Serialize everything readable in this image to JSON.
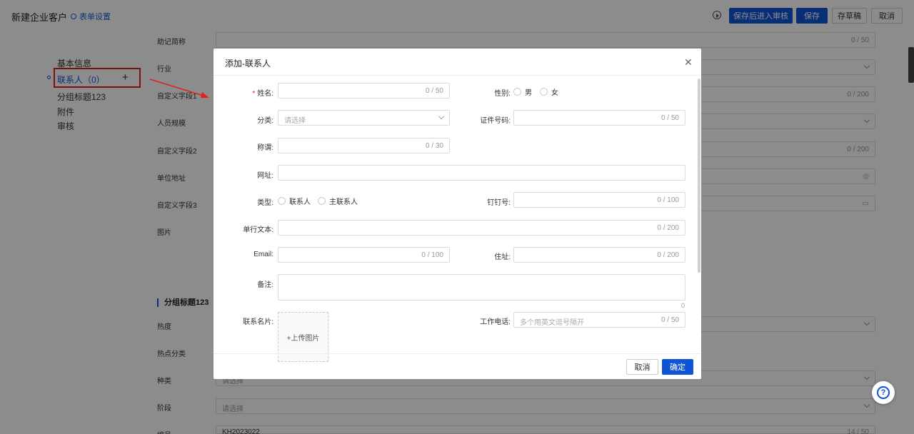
{
  "header": {
    "title": "新建企业客户",
    "form_settings": "表单设置",
    "buttons": {
      "save_and_review": "保存后进入审核",
      "save": "保存",
      "draft": "存草稿",
      "cancel": "取消"
    }
  },
  "sidebar": {
    "items": [
      "基本信息",
      "联系人（0）",
      "分组标题123",
      "附件",
      "审核"
    ]
  },
  "form": {
    "fields": [
      {
        "label": "助记简称",
        "count": "0 / 50"
      },
      {
        "label": "行业"
      },
      {
        "label": "自定义字段1",
        "count": "0 / 200"
      },
      {
        "label": "人员规模"
      },
      {
        "label": "自定义字段2",
        "count": "0 / 200"
      },
      {
        "label": "单位地址"
      },
      {
        "label": "自定义字段3"
      },
      {
        "label": "图片"
      }
    ],
    "section_title": "分组标题123",
    "section_fields": [
      {
        "label": "热度"
      },
      {
        "label": "热点分类"
      },
      {
        "label": "种类",
        "placeholder": "请选择"
      },
      {
        "label": "阶段",
        "placeholder": "请选择"
      },
      {
        "label": "编号",
        "value": "KH2023022",
        "count": "14 / 50"
      }
    ]
  },
  "modal": {
    "title": "添加-联系人",
    "fields": {
      "name": {
        "label": "姓名:",
        "count": "0 / 50"
      },
      "gender": {
        "label": "性别:",
        "options": [
          "男",
          "女"
        ]
      },
      "category": {
        "label": "分类:",
        "placeholder": "请选择"
      },
      "id_number": {
        "label": "证件号码:",
        "count": "0 / 50"
      },
      "title": {
        "label": "称谓:",
        "count": "0 / 30"
      },
      "website": {
        "label": "网址:"
      },
      "type": {
        "label": "类型:",
        "options": [
          "联系人",
          "主联系人"
        ]
      },
      "dingtalk": {
        "label": "钉钉号:",
        "count": "0 / 100"
      },
      "single_line": {
        "label": "单行文本:",
        "count": "0 / 200"
      },
      "email": {
        "label": "Email:",
        "count": "0 / 100"
      },
      "address": {
        "label": "住址:",
        "count": "0 / 200"
      },
      "remark": {
        "label": "备注:",
        "count": "0"
      },
      "business_card": {
        "label": "联系名片:",
        "upload_label": "+上传图片"
      },
      "work_phone": {
        "label": "工作电话:",
        "placeholder": "多个用英文逗号隔开",
        "count": "0 / 50"
      }
    },
    "buttons": {
      "cancel": "取消",
      "confirm": "确定"
    }
  },
  "help": {
    "icon": "?"
  }
}
